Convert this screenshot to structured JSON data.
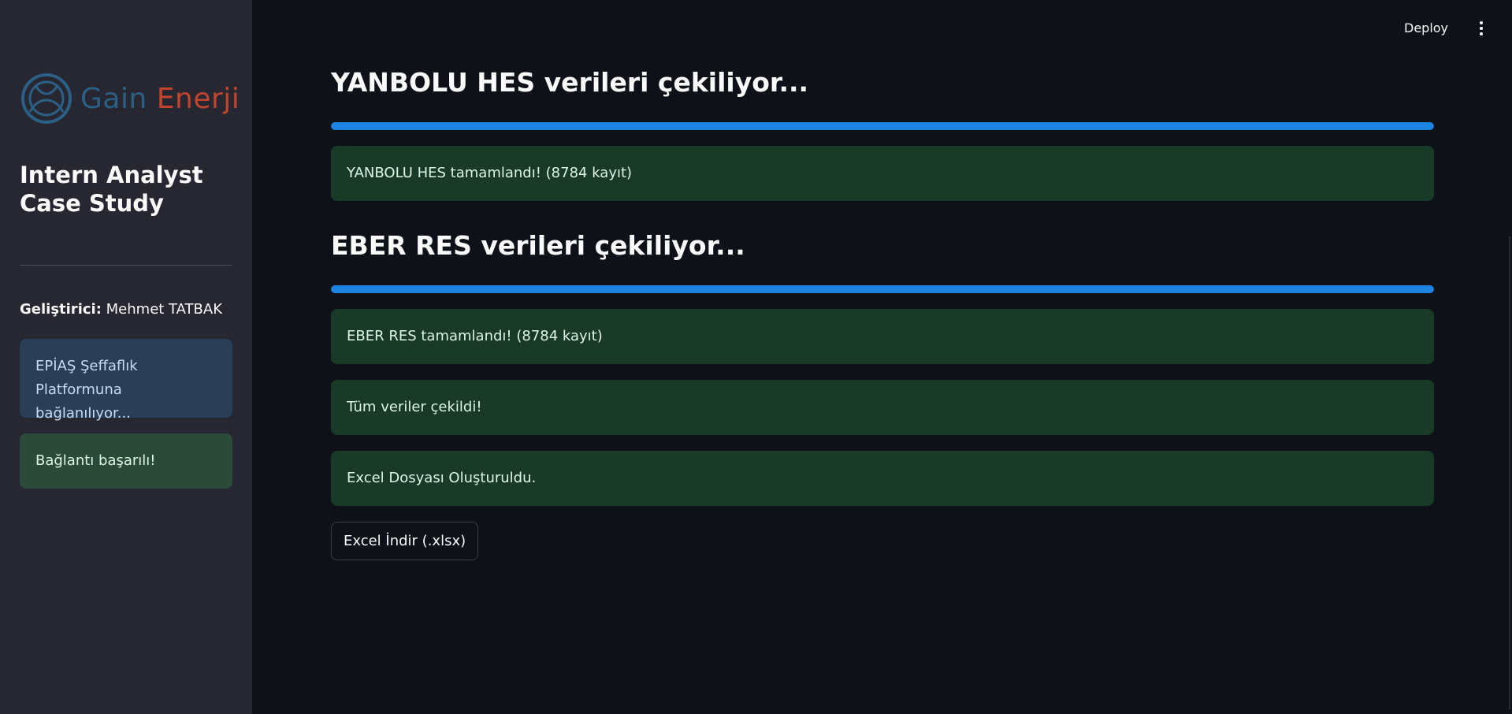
{
  "header": {
    "deploy_label": "Deploy",
    "menu_icon": "more-vertical-icon"
  },
  "sidebar": {
    "logo": {
      "icon": "gain-enerji-logo-icon",
      "word1": "Gain",
      "word2": "Enerji"
    },
    "title": "Intern Analyst Case Study",
    "developer_label": "Geliştirici:",
    "developer_name": "Mehmet TATBAK",
    "info_message": "EPİAŞ Şeffaflık Platformuna bağlanılıyor...",
    "success_message": "Bağlantı başarılı!"
  },
  "main": {
    "sections": [
      {
        "heading": "YANBOLU HES verileri çekiliyor...",
        "progress": 1.0,
        "message": "YANBOLU HES tamamlandı! (8784 kayıt)"
      },
      {
        "heading": "EBER RES verileri çekiliyor...",
        "progress": 1.0,
        "message": "EBER RES tamamlandı! (8784 kayıt)"
      }
    ],
    "status_messages": [
      "Tüm veriler çekildi!",
      "Excel Dosyası Oluşturuldu."
    ],
    "download_button": "Excel İndir (.xlsx)"
  },
  "colors": {
    "background": "#0e1117",
    "sidebar": "#262730",
    "progress": "#1c83e1",
    "success_bg": "#1a3a28",
    "info_bg": "#2a3e58",
    "logo_blue": "#2c5f86",
    "logo_red": "#c1442e"
  }
}
